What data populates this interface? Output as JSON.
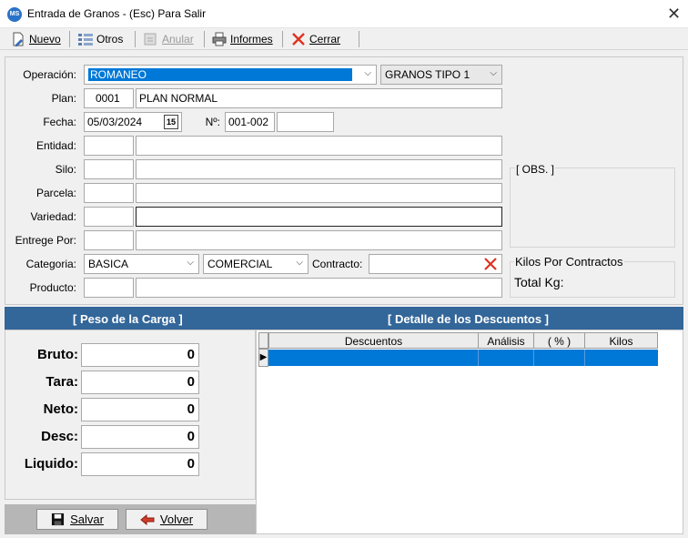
{
  "window": {
    "title": "Entrada de Granos  -  (Esc) Para Salir",
    "logo_text": "MS"
  },
  "toolbar": {
    "nuevo": "Nuevo",
    "otros": "Otros",
    "anular": "Anular",
    "informes": "Informes",
    "cerrar": "Cerrar"
  },
  "form": {
    "operacion_label": "Operación:",
    "operacion_value": "ROMANEO",
    "tipo_value": "GRANOS TIPO 1",
    "plan_label": "Plan:",
    "plan_code": "0001",
    "plan_name": "PLAN NORMAL",
    "fecha_label": "Fecha:",
    "fecha_value": "05/03/2024",
    "calendar_day": "15",
    "numero_label": "Nº:",
    "numero_value": "001-002",
    "numero_extra": "",
    "entidad_label": "Entidad:",
    "silo_label": "Silo:",
    "parcela_label": "Parcela:",
    "variedad_label": "Variedad:",
    "entrege_label": "Entrege Por:",
    "categoria_label": "Categoria:",
    "categoria_value": "BASICA",
    "categoria2_value": "COMERCIAL",
    "contracto_label": "Contracto:",
    "producto_label": "Producto:"
  },
  "side": {
    "obs_label": "[ OBS. ]",
    "kilos_label": "Kilos Por Contractos",
    "total_label": "Total Kg:"
  },
  "sections": {
    "peso_title": "[ Peso de la Carga ]",
    "detalle_title": "[ Detalle de los Descuentos ]"
  },
  "weights": [
    {
      "label": "Bruto:",
      "value": "0"
    },
    {
      "label": "Tara:",
      "value": "0"
    },
    {
      "label": "Neto:",
      "value": "0"
    },
    {
      "label": "Desc:",
      "value": "0"
    },
    {
      "label": "Liquido:",
      "value": "0"
    }
  ],
  "buttons": {
    "salvar": "Salvar",
    "volver": "Volver"
  },
  "grid": {
    "columns": [
      "Descuentos",
      "Análisis",
      "( % )",
      "Kilos"
    ]
  },
  "colors": {
    "section_bar": "#336699",
    "selection": "#0078d7",
    "clear_x": "#e0321e"
  }
}
